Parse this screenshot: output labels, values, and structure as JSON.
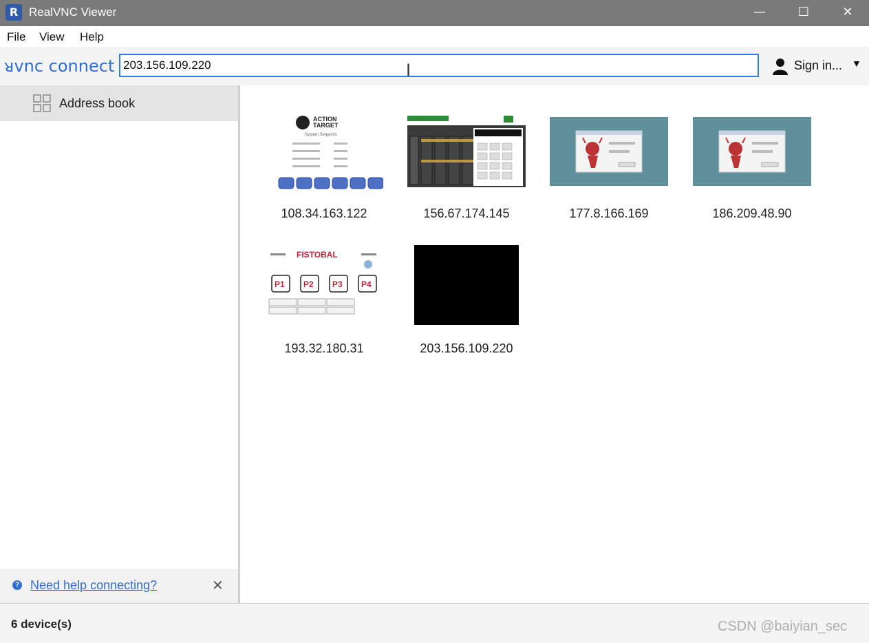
{
  "window": {
    "title": "RealVNC Viewer"
  },
  "menu": [
    "File",
    "View",
    "Help"
  ],
  "toolbar": {
    "logo_text": "ᴚvnc connect",
    "address_value": "203.156.109.220",
    "signin_label": "Sign in..."
  },
  "sidebar": {
    "address_book_label": "Address book",
    "help_link": "Need help connecting?"
  },
  "devices": [
    {
      "address": "108.34.163.122",
      "thumb": "action-target"
    },
    {
      "address": "156.67.174.145",
      "thumb": "dark-keypad"
    },
    {
      "address": "177.8.166.169",
      "thumb": "bsd-daemon-dialog"
    },
    {
      "address": "186.209.48.90",
      "thumb": "bsd-daemon-dialog"
    },
    {
      "address": "193.32.180.31",
      "thumb": "fistobal-panel"
    },
    {
      "address": "203.156.109.220",
      "thumb": "black"
    }
  ],
  "thumb_text": {
    "action_target": [
      "ACTION",
      "TARGET",
      "System Setpoints"
    ],
    "fistobal": "FISTOBAL",
    "fistobal_buttons": [
      "P1",
      "P2",
      "P3",
      "P4"
    ]
  },
  "status": {
    "device_count": "6 device(s)"
  },
  "watermark": "CSDN @baiyian_sec",
  "colors": {
    "accent": "#2f6fd1",
    "titlebar": "#7a7a7a",
    "thumb_teal": "#5e8f9a"
  }
}
